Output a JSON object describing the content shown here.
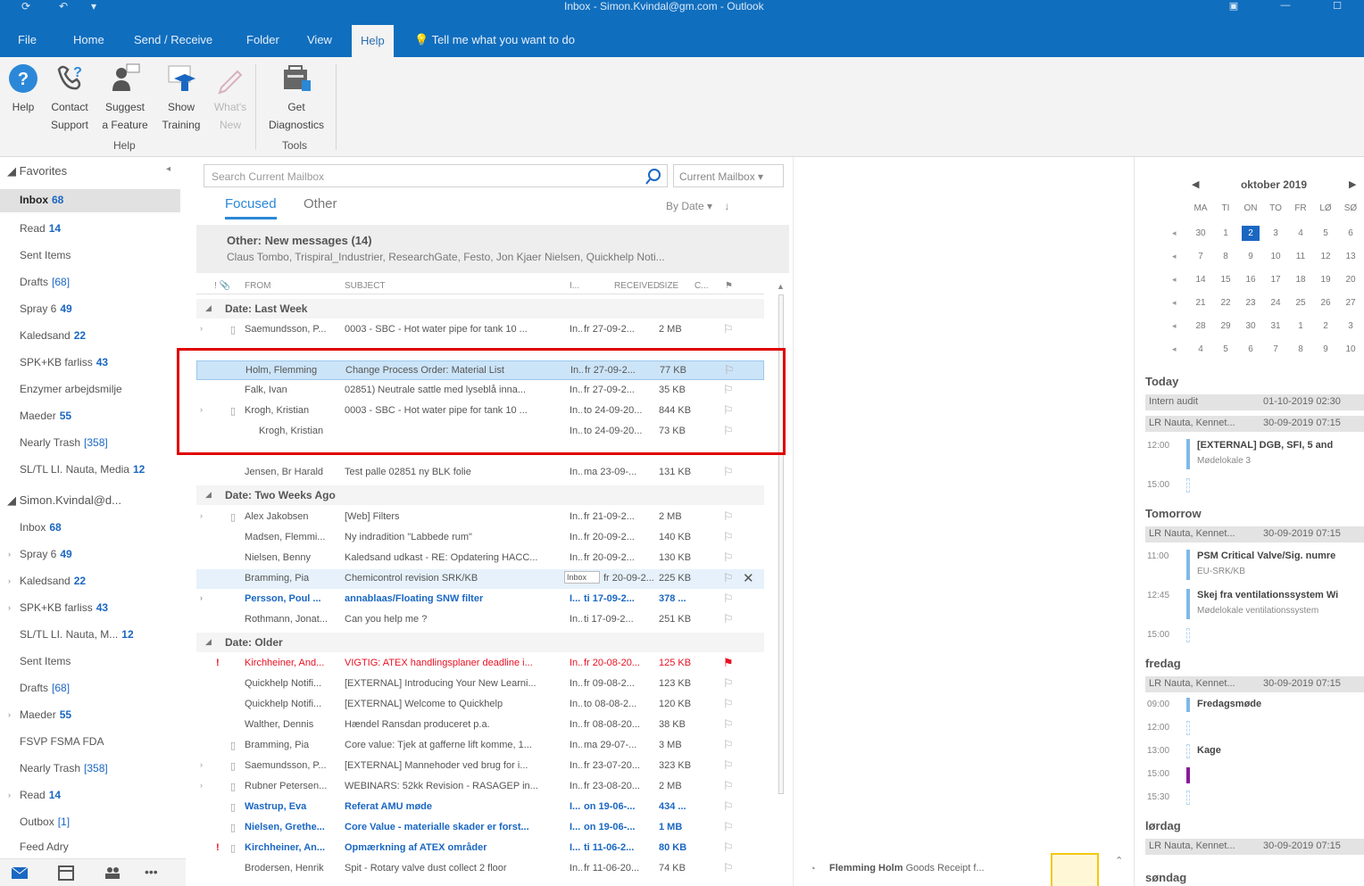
{
  "window": {
    "title": "Inbox - Simon.Kvindal@gm.com - Outlook"
  },
  "tabs": {
    "file": "File",
    "home": "Home",
    "send_receive": "Send / Receive",
    "folder": "Folder",
    "view": "View",
    "help": "Help",
    "tell_me": "Tell me what you want to do"
  },
  "ribbon": {
    "help": "Help",
    "contact_support_1": "Contact",
    "contact_support_2": "Support",
    "suggest_feature_1": "Suggest",
    "suggest_feature_2": "a Feature",
    "show_training_1": "Show",
    "show_training_2": "Training",
    "whats_new_1": "What's",
    "whats_new_2": "New",
    "get_diagnostics_1": "Get",
    "get_diagnostics_2": "Diagnostics",
    "group_help": "Help",
    "group_tools": "Tools"
  },
  "folders": {
    "favorites": "Favorites",
    "items": [
      {
        "name": "Inbox",
        "count": "68"
      },
      {
        "name": "Read",
        "count": "14"
      },
      {
        "name": "Sent Items",
        "count": ""
      },
      {
        "name": "Drafts",
        "count": "[68]"
      },
      {
        "name": "Spray 6",
        "count": "49"
      },
      {
        "name": "Kaledsand",
        "count": "22"
      },
      {
        "name": "SPK+KB farliss",
        "count": "43"
      },
      {
        "name": "Enzymer arbejdsmilje",
        "count": ""
      },
      {
        "name": "Maeder",
        "count": "55"
      },
      {
        "name": "Nearly Trash",
        "count": "[358]"
      },
      {
        "name": "SL/TL LI. Nauta, Media",
        "count": "12"
      }
    ],
    "account": "Simon.Kvindal@d...",
    "account_items": [
      {
        "name": "Inbox",
        "count": "68"
      },
      {
        "name": "Spray 6",
        "count": "49"
      },
      {
        "name": "Kaledsand",
        "count": "22"
      },
      {
        "name": "SPK+KB farliss",
        "count": "43"
      },
      {
        "name": "SL/TL LI. Nauta, M...",
        "count": "12"
      },
      {
        "name": "Sent Items",
        "count": ""
      },
      {
        "name": "Drafts",
        "count": "[68]"
      },
      {
        "name": "Maeder",
        "count": "55"
      },
      {
        "name": "FSVP FSMA FDA",
        "count": ""
      },
      {
        "name": "Nearly Trash",
        "count": "[358]"
      },
      {
        "name": "Read",
        "count": "14"
      },
      {
        "name": "Outbox",
        "count": "[1]"
      },
      {
        "name": "Feed Adry",
        "count": ""
      }
    ]
  },
  "list": {
    "search_placeholder": "Search Current Mailbox",
    "scope": "Current Mailbox",
    "tab_focused": "Focused",
    "tab_other": "Other",
    "sort": "By Date",
    "other_title": "Other: New messages (14)",
    "other_senders": "Claus Tombo, Trispiral_Industrier, ResearchGate, Festo, Jon Kjaer Nielsen, Quickhelp Noti...",
    "col_from": "FROM",
    "col_subject": "SUBJECT",
    "col_in": "I...",
    "col_received": "RECEIVED",
    "col_size": "SIZE",
    "col_c": "C...",
    "group_last_week": "Date: Last Week",
    "group_two_weeks": "Date: Two Weeks Ago",
    "group_older": "Date: Older",
    "rows_last_week": [
      {
        "from": "Saemundsson, P...",
        "subject": "0003 - SBC - Hot water pipe for tank 10 ...",
        "in": "In...",
        "received": "fr 27-09-2...",
        "size": "2 MB"
      },
      {
        "from": "Holm, Flemming",
        "subject": "Change Process Order: Material List",
        "in": "In...",
        "received": "fr 27-09-2...",
        "size": "77 KB"
      },
      {
        "from": "Falk, Ivan",
        "subject": "02851) Neutrale sattle med lyseblå inna...",
        "in": "In...",
        "received": "fr 27-09-2...",
        "size": "35 KB"
      },
      {
        "from": "Krogh, Kristian",
        "subject": "0003 - SBC - Hot water pipe for tank 10 ...",
        "in": "In...",
        "received": "to 24-09-20...",
        "size": "844 KB"
      },
      {
        "from": "Krogh, Kristian",
        "subject": "",
        "in": "In...",
        "received": "to 24-09-20...",
        "size": "73 KB"
      },
      {
        "from": "Jensen, Br Harald",
        "subject": "Test palle 02851 ny BLK folie",
        "in": "In...",
        "received": "ma 23-09-...",
        "size": "131 KB"
      }
    ],
    "rows_two_weeks": [
      {
        "from": "Alex Jakobsen",
        "subject": "[Web] Filters",
        "in": "In...",
        "received": "fr 21-09-2...",
        "size": "2 MB"
      },
      {
        "from": "Madsen, Flemmi...",
        "subject": "Ny indradition \"Labbede rum\"",
        "in": "In...",
        "received": "fr 20-09-2...",
        "size": "140 KB"
      },
      {
        "from": "Nielsen, Benny",
        "subject": "Kaledsand udkast - RE: Opdatering HACC...",
        "in": "In...",
        "received": "fr 20-09-2...",
        "size": "130 KB"
      },
      {
        "from": "Bramming, Pia",
        "subject": "Chemicontrol revision SRK/KB",
        "in": "Inbox",
        "received": "fr 20-09-2...",
        "size": "225 KB"
      },
      {
        "from": "Persson, Poul ...",
        "subject": "annablaas/Floating SNW filter",
        "in": "I...",
        "received": "ti 17-09-2...",
        "size": "378 ..."
      },
      {
        "from": "Rothmann, Jonat...",
        "subject": "Can you help me ?",
        "in": "In...",
        "received": "ti 17-09-2...",
        "size": "251 KB"
      }
    ],
    "rows_older": [
      {
        "from": "Kirchheiner, And...",
        "subject": "VIGTIG: ATEX handlingsplaner deadline i...",
        "in": "In...",
        "received": "fr 20-08-20...",
        "size": "125 KB"
      },
      {
        "from": "Quickhelp Notifi...",
        "subject": "[EXTERNAL] Introducing Your New Learni...",
        "in": "In...",
        "received": "fr 09-08-2...",
        "size": "123 KB"
      },
      {
        "from": "Quickhelp Notifi...",
        "subject": "[EXTERNAL] Welcome to Quickhelp",
        "in": "In...",
        "received": "to 08-08-2...",
        "size": "120 KB"
      },
      {
        "from": "Walther, Dennis",
        "subject": "Hændel Ransdan produceret p.a.",
        "in": "In...",
        "received": "fr 08-08-20...",
        "size": "38 KB"
      },
      {
        "from": "Bramming, Pia",
        "subject": "Core value: Tjek at gafferne lift komme, 1...",
        "in": "In...",
        "received": "ma 29-07-...",
        "size": "3 MB"
      },
      {
        "from": "Saemundsson, P...",
        "subject": "[EXTERNAL] Mannehoder ved brug for i...",
        "in": "In...",
        "received": "fr 23-07-20...",
        "size": "323 KB"
      },
      {
        "from": "Rubner Petersen...",
        "subject": "WEBINARS: 52kk Revision - RASAGEP in...",
        "in": "In...",
        "received": "fr 23-08-20...",
        "size": "2 MB"
      },
      {
        "from": "Wastrup, Eva",
        "subject": "Referat AMU møde",
        "in": "I...",
        "received": "on 19-06-...",
        "size": "434 ..."
      },
      {
        "from": "Nielsen, Grethe...",
        "subject": "Core Value - materialle skader er forst...",
        "in": "I...",
        "received": "on 19-06-...",
        "size": "1 MB"
      },
      {
        "from": "Kirchheiner, An...",
        "subject": "Opmærkning af ATEX områder",
        "in": "I...",
        "received": "ti 11-06-2...",
        "size": "80 KB"
      },
      {
        "from": "Brodersen, Henrik",
        "subject": "Spit - Rotary valve dust collect 2 floor",
        "in": "In...",
        "received": "fr 11-06-20...",
        "size": "74 KB"
      }
    ]
  },
  "notification": {
    "sender": "Flemming Holm",
    "text": "Goods Receipt f..."
  },
  "todo": {
    "month": "oktober 2019",
    "dow": [
      "MA",
      "TI",
      "ON",
      "TO",
      "FR",
      "LØ",
      "SØ"
    ],
    "weeks": [
      [
        "30",
        "1",
        "2",
        "3",
        "4",
        "5",
        "6"
      ],
      [
        "7",
        "8",
        "9",
        "10",
        "11",
        "12",
        "13"
      ],
      [
        "14",
        "15",
        "16",
        "17",
        "18",
        "19",
        "20"
      ],
      [
        "21",
        "22",
        "23",
        "24",
        "25",
        "26",
        "27"
      ],
      [
        "28",
        "29",
        "30",
        "31",
        "1",
        "2",
        "3"
      ],
      [
        "4",
        "5",
        "6",
        "7",
        "8",
        "9",
        "10"
      ]
    ],
    "today_label": "Today",
    "today_allday_1": "Intern audit",
    "today_allday_1_time": "01-10-2019 02:30",
    "today_allday_2": "LR Nauta, Kennet...",
    "today_allday_2_time": "30-09-2019 07:15",
    "today_ev1_time": "12:00",
    "today_ev1_title": "[EXTERNAL] DGB, SFI, 5 and",
    "today_ev1_sub": "Mødelokale 3",
    "today_ev2_time": "15:00",
    "tomorrow_label": "Tomorrow",
    "tomorrow_allday": "LR Nauta, Kennet...",
    "tomorrow_allday_time": "30-09-2019 07:15",
    "tom_ev1_time": "11:00",
    "tom_ev1_title": "PSM Critical Valve/Sig. numre",
    "tom_ev1_sub": "EU-SRK/KB",
    "tom_ev2_time": "12:45",
    "tom_ev2_title": "Skej fra ventilationssystem Wi",
    "tom_ev2_sub": "Mødelokale ventilationssystem",
    "tom_ev3_time": "15:00",
    "friday_label": "fredag",
    "friday_allday": "LR Nauta, Kennet...",
    "friday_allday_time": "30-09-2019 07:15",
    "fri_ev1_time": "09:00",
    "fri_ev1_title": "Fredagsmøde",
    "fri_ev2_time": "12:00",
    "fri_ev3_time": "13:00",
    "fri_ev3_title": "Kage",
    "fri_ev4_time": "15:00",
    "fri_ev5_time": "15:30",
    "saturday_label": "lørdag",
    "saturday_allday": "LR Nauta, Kennet...",
    "saturday_allday_time": "30-09-2019 07:15",
    "sunday_label": "søndag"
  }
}
